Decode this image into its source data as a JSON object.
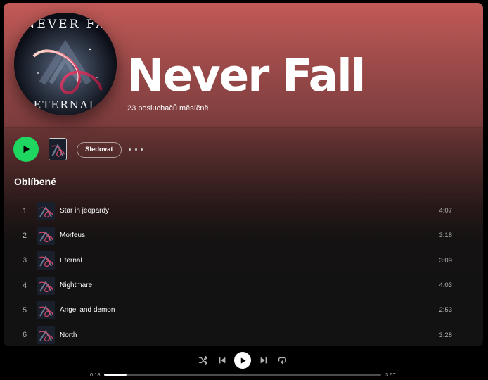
{
  "artist": {
    "name": "Never Fall",
    "listeners": "23 posluchačů měsíčně",
    "image_text_top": "NEVER FA",
    "image_text_bottom": "ETERNAL"
  },
  "actions": {
    "follow_label": "Sledovat",
    "more_label": "..."
  },
  "popular": {
    "title": "Oblíbené",
    "tracks": [
      {
        "num": "1",
        "title": "Star in jeopardy",
        "duration": "4:07"
      },
      {
        "num": "2",
        "title": "Morfeus",
        "duration": "3:18"
      },
      {
        "num": "3",
        "title": "Eternal",
        "duration": "3:09"
      },
      {
        "num": "4",
        "title": "Nightmare",
        "duration": "4:03"
      },
      {
        "num": "5",
        "title": "Angel and demon",
        "duration": "2:53"
      },
      {
        "num": "6",
        "title": "North",
        "duration": "3:28"
      }
    ]
  },
  "player": {
    "current_time": "0:18",
    "total_time": "3:57",
    "progress_fraction": 0.08
  },
  "colors": {
    "accent": "#1ed760",
    "header": "#c25a57",
    "background": "#121212"
  }
}
